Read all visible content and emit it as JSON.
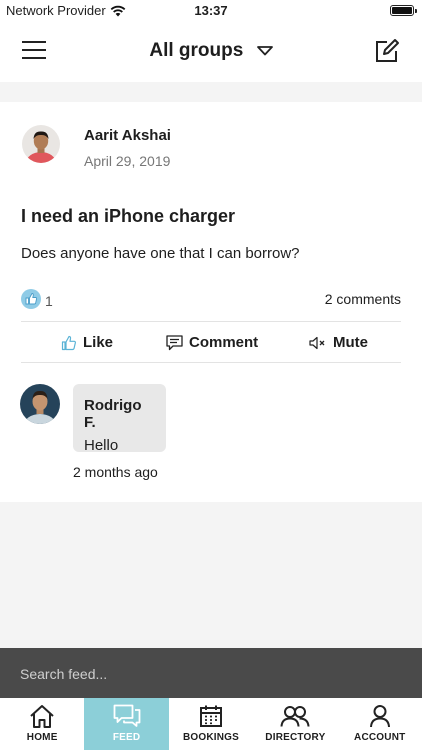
{
  "status_bar": {
    "carrier": "Network Provider",
    "time": "13:37"
  },
  "nav": {
    "title": "All groups"
  },
  "post": {
    "author_name": "Aarit Akshai",
    "date": "April 29, 2019",
    "title": "I need an iPhone charger",
    "body": "Does anyone have one that I can borrow?",
    "like_count": "1",
    "comments_count": "2 comments",
    "actions": {
      "like": "Like",
      "comment": "Comment",
      "mute": "Mute"
    }
  },
  "comment": {
    "author": "Rodrigo F.",
    "text": "Hello",
    "time": "2 months ago"
  },
  "search": {
    "placeholder": "Search feed..."
  },
  "tabs": [
    {
      "label": "HOME",
      "icon": "home-icon"
    },
    {
      "label": "FEED",
      "icon": "chat-icon"
    },
    {
      "label": "BOOKINGS",
      "icon": "calendar-icon"
    },
    {
      "label": "DIRECTORY",
      "icon": "people-icon"
    },
    {
      "label": "ACCOUNT",
      "icon": "user-icon"
    }
  ],
  "active_tab": "FEED",
  "colors": {
    "accent": "#8ccfd8",
    "like_icon": "#5bb3d6",
    "search_bar": "#4a4a4a"
  }
}
